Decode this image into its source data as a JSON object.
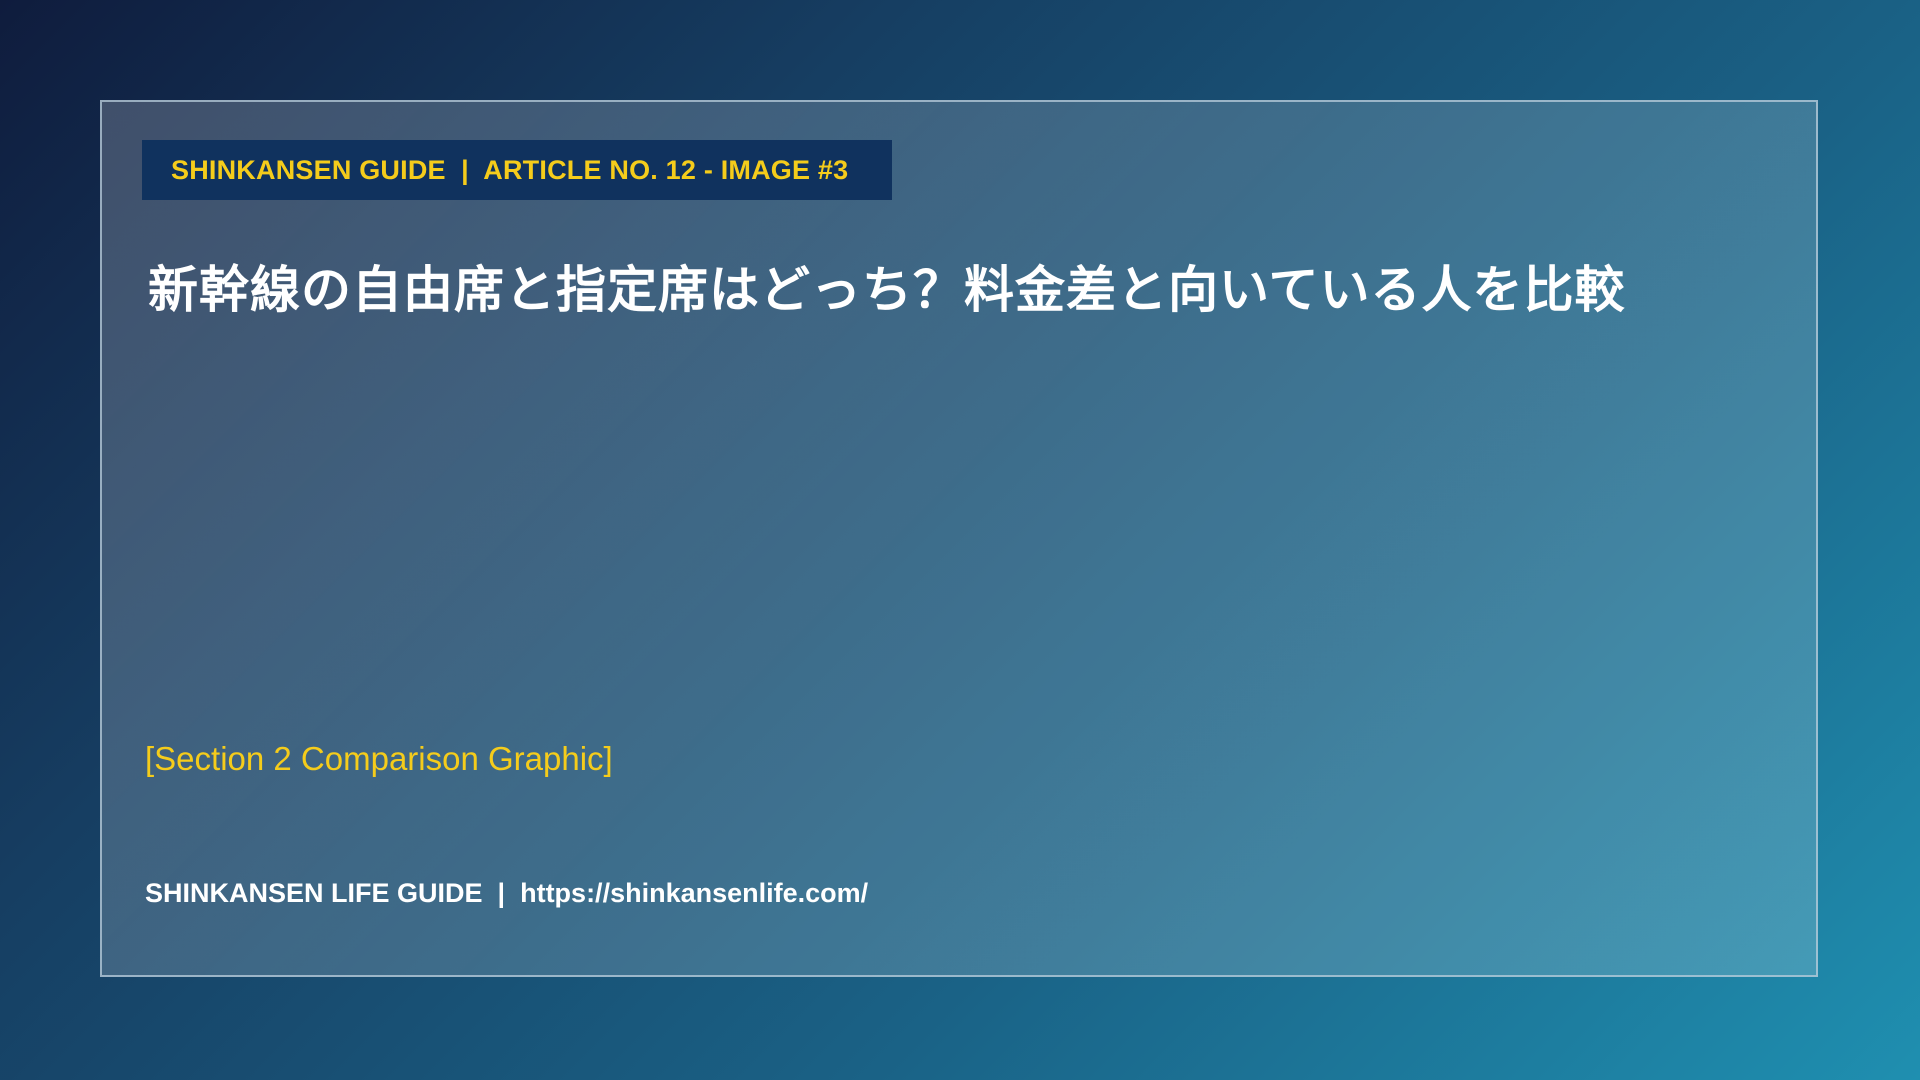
{
  "badge": {
    "text": "SHINKANSEN GUIDE  |  ARTICLE NO. 12 - IMAGE #3"
  },
  "title": "新幹線の自由席と指定席はどっち？料金差と向いている人を比較",
  "placeholder": "[Section 2 Comparison Graphic]",
  "footer": {
    "text": "SHINKANSEN LIFE GUIDE  |  https://shinkansenlife.com/"
  },
  "colors": {
    "accent_yellow": "#f5cc1b",
    "badge_background": "#10325e",
    "title_text": "#ffffff"
  }
}
